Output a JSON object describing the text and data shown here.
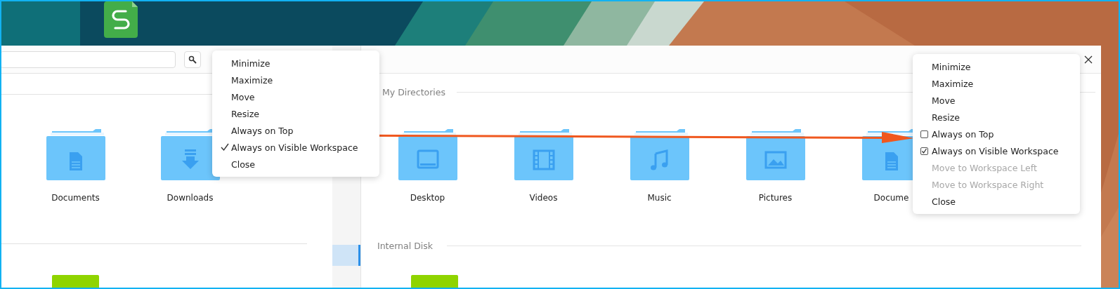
{
  "left_window": {
    "folders": [
      {
        "label": "Documents",
        "kind": "documents"
      },
      {
        "label": "Downloads",
        "kind": "downloads"
      }
    ]
  },
  "right_window": {
    "sidebar": {
      "items": [
        {
          "selected": true
        }
      ]
    },
    "sections": [
      {
        "title": "My Directories"
      },
      {
        "title": "Internal Disk"
      }
    ],
    "folders": [
      {
        "label": "Desktop",
        "kind": "desktop"
      },
      {
        "label": "Videos",
        "kind": "videos"
      },
      {
        "label": "Music",
        "kind": "music"
      },
      {
        "label": "Pictures",
        "kind": "pictures"
      },
      {
        "label": "Docume",
        "kind": "documents"
      }
    ]
  },
  "menus": [
    {
      "kind": "tick",
      "items": [
        {
          "label": "Minimize",
          "kind": "action",
          "disabled": false
        },
        {
          "label": "Maximize",
          "kind": "action",
          "disabled": false
        },
        {
          "label": "Move",
          "kind": "action",
          "disabled": false
        },
        {
          "label": "Resize",
          "kind": "action",
          "disabled": false
        },
        {
          "label": "Always on Top",
          "kind": "toggle",
          "checked": false,
          "disabled": false
        },
        {
          "label": "Always on Visible Workspace",
          "kind": "toggle",
          "checked": true,
          "disabled": false
        },
        {
          "label": "Close",
          "kind": "action",
          "disabled": false
        }
      ]
    },
    {
      "kind": "box",
      "items": [
        {
          "label": "Minimize",
          "kind": "action",
          "disabled": false
        },
        {
          "label": "Maximize",
          "kind": "action",
          "disabled": false
        },
        {
          "label": "Move",
          "kind": "action",
          "disabled": false
        },
        {
          "label": "Resize",
          "kind": "action",
          "disabled": false
        },
        {
          "label": "Always on Top",
          "kind": "toggle",
          "checked": false,
          "disabled": false
        },
        {
          "label": "Always on Visible Workspace",
          "kind": "toggle",
          "checked": true,
          "disabled": false
        },
        {
          "label": "Move to Workspace Left",
          "kind": "action",
          "disabled": true
        },
        {
          "label": "Move to Workspace Right",
          "kind": "action",
          "disabled": true
        },
        {
          "label": "Close",
          "kind": "action",
          "disabled": false
        }
      ]
    }
  ]
}
